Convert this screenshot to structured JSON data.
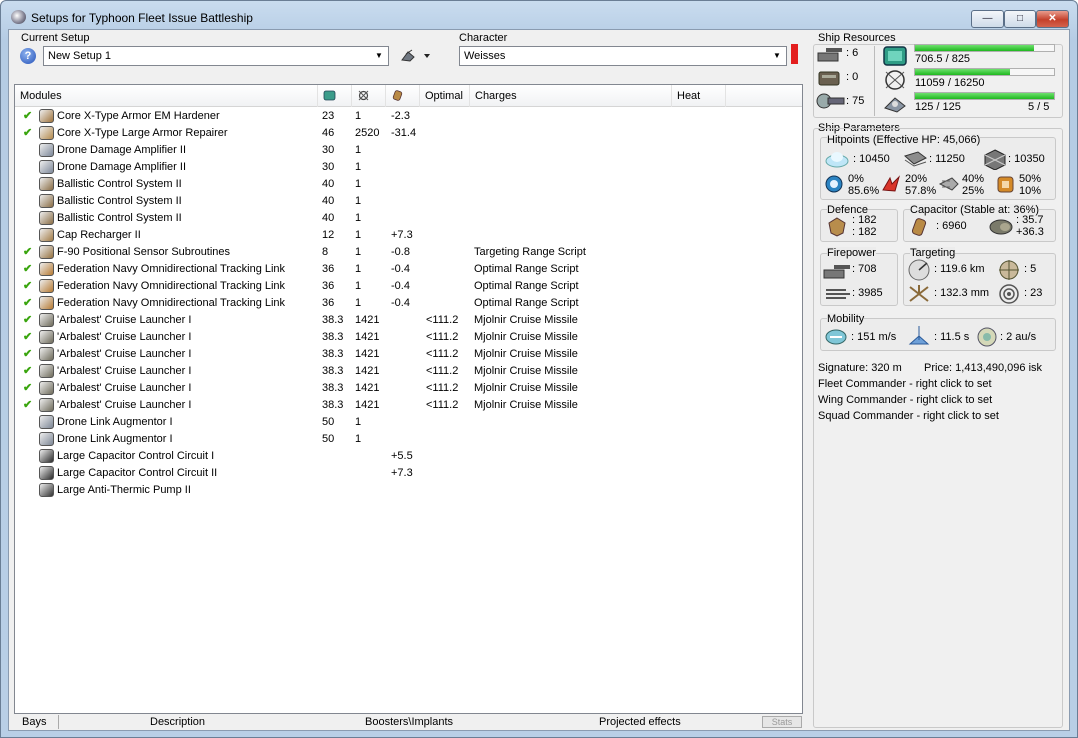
{
  "window": {
    "title": "Setups for Typhoon Fleet Issue Battleship",
    "min": "—",
    "max": "□",
    "close": "✕"
  },
  "setup": {
    "label": "Current Setup",
    "value": "New Setup 1"
  },
  "character": {
    "label": "Character",
    "value": "Weisses"
  },
  "modules": {
    "columns": [
      "Modules",
      "",
      "",
      "",
      "Optimal",
      "Charges",
      "Heat"
    ],
    "column_icons": [
      "cpu-icon",
      "powergrid-icon",
      "capacitor-icon"
    ],
    "rows": [
      {
        "check": "✔",
        "icon": "armor-hardener-icon",
        "name": "Core X-Type Armor EM Hardener",
        "cpu": "23",
        "pg": "1",
        "cap": "-2.3",
        "optimal": "",
        "charge": ""
      },
      {
        "check": "✔",
        "icon": "armor-repairer-icon",
        "name": "Core X-Type Large Armor Repairer",
        "cpu": "46",
        "pg": "2520",
        "cap": "-31.4",
        "optimal": "",
        "charge": ""
      },
      {
        "check": "",
        "icon": "drone-damage-amplifier-icon",
        "name": "Drone Damage Amplifier II",
        "cpu": "30",
        "pg": "1",
        "cap": "",
        "optimal": "",
        "charge": ""
      },
      {
        "check": "",
        "icon": "drone-damage-amplifier-icon",
        "name": "Drone Damage Amplifier II",
        "cpu": "30",
        "pg": "1",
        "cap": "",
        "optimal": "",
        "charge": ""
      },
      {
        "check": "",
        "icon": "ballistic-control-icon",
        "name": "Ballistic Control System II",
        "cpu": "40",
        "pg": "1",
        "cap": "",
        "optimal": "",
        "charge": ""
      },
      {
        "check": "",
        "icon": "ballistic-control-icon",
        "name": "Ballistic Control System II",
        "cpu": "40",
        "pg": "1",
        "cap": "",
        "optimal": "",
        "charge": ""
      },
      {
        "check": "",
        "icon": "ballistic-control-icon",
        "name": "Ballistic Control System II",
        "cpu": "40",
        "pg": "1",
        "cap": "",
        "optimal": "",
        "charge": ""
      },
      {
        "check": "",
        "icon": "cap-recharger-icon",
        "name": "Cap Recharger II",
        "cpu": "12",
        "pg": "1",
        "cap": "+7.3",
        "optimal": "",
        "charge": ""
      },
      {
        "check": "✔",
        "icon": "sensor-subroutines-icon",
        "name": "F-90 Positional Sensor Subroutines",
        "cpu": "8",
        "pg": "1",
        "cap": "-0.8",
        "optimal": "",
        "charge": "Targeting Range Script"
      },
      {
        "check": "✔",
        "icon": "tracking-link-icon",
        "name": "Federation Navy Omnidirectional Tracking Link",
        "cpu": "36",
        "pg": "1",
        "cap": "-0.4",
        "optimal": "",
        "charge": "Optimal Range Script"
      },
      {
        "check": "✔",
        "icon": "tracking-link-icon",
        "name": "Federation Navy Omnidirectional Tracking Link",
        "cpu": "36",
        "pg": "1",
        "cap": "-0.4",
        "optimal": "",
        "charge": "Optimal Range Script"
      },
      {
        "check": "✔",
        "icon": "tracking-link-icon",
        "name": "Federation Navy Omnidirectional Tracking Link",
        "cpu": "36",
        "pg": "1",
        "cap": "-0.4",
        "optimal": "",
        "charge": "Optimal Range Script"
      },
      {
        "check": "✔",
        "icon": "cruise-launcher-icon",
        "name": "'Arbalest' Cruise Launcher I",
        "cpu": "38.3",
        "pg": "1421",
        "cap": "",
        "optimal": "<111.2",
        "charge": "Mjolnir Cruise Missile"
      },
      {
        "check": "✔",
        "icon": "cruise-launcher-icon",
        "name": "'Arbalest' Cruise Launcher I",
        "cpu": "38.3",
        "pg": "1421",
        "cap": "",
        "optimal": "<111.2",
        "charge": "Mjolnir Cruise Missile"
      },
      {
        "check": "✔",
        "icon": "cruise-launcher-icon",
        "name": "'Arbalest' Cruise Launcher I",
        "cpu": "38.3",
        "pg": "1421",
        "cap": "",
        "optimal": "<111.2",
        "charge": "Mjolnir Cruise Missile"
      },
      {
        "check": "✔",
        "icon": "cruise-launcher-icon",
        "name": "'Arbalest' Cruise Launcher I",
        "cpu": "38.3",
        "pg": "1421",
        "cap": "",
        "optimal": "<111.2",
        "charge": "Mjolnir Cruise Missile"
      },
      {
        "check": "✔",
        "icon": "cruise-launcher-icon",
        "name": "'Arbalest' Cruise Launcher I",
        "cpu": "38.3",
        "pg": "1421",
        "cap": "",
        "optimal": "<111.2",
        "charge": "Mjolnir Cruise Missile"
      },
      {
        "check": "✔",
        "icon": "cruise-launcher-icon",
        "name": "'Arbalest' Cruise Launcher I",
        "cpu": "38.3",
        "pg": "1421",
        "cap": "",
        "optimal": "<111.2",
        "charge": "Mjolnir Cruise Missile"
      },
      {
        "check": "",
        "icon": "drone-link-augmentor-icon",
        "name": "Drone Link Augmentor I",
        "cpu": "50",
        "pg": "1",
        "cap": "",
        "optimal": "",
        "charge": ""
      },
      {
        "check": "",
        "icon": "drone-link-augmentor-icon",
        "name": "Drone Link Augmentor I",
        "cpu": "50",
        "pg": "1",
        "cap": "",
        "optimal": "",
        "charge": ""
      },
      {
        "check": "",
        "icon": "capacitor-control-circuit-icon",
        "name": "Large Capacitor Control Circuit I",
        "cpu": "",
        "pg": "",
        "cap": "+5.5",
        "optimal": "",
        "charge": ""
      },
      {
        "check": "",
        "icon": "capacitor-control-circuit-icon",
        "name": "Large Capacitor Control Circuit II",
        "cpu": "",
        "pg": "",
        "cap": "+7.3",
        "optimal": "",
        "charge": ""
      },
      {
        "check": "",
        "icon": "anti-thermic-pump-icon",
        "name": "Large Anti-Thermic Pump II",
        "cpu": "",
        "pg": "",
        "cap": "",
        "optimal": "",
        "charge": ""
      }
    ]
  },
  "bottom_tabs": [
    "Bays",
    "Description",
    "Boosters\\Implants",
    "Projected effects",
    "Stats"
  ],
  "resources": {
    "title": "Ship Resources",
    "turrets": ": 6",
    "launchers": ": 0",
    "calibration": ": 75",
    "cpu": {
      "text": "706.5 / 825",
      "fraction": 0.856
    },
    "powergrid": {
      "text": "11059 / 16250",
      "fraction": 0.681
    },
    "drone_bandwidth": {
      "text": "125 / 125",
      "fraction": 1.0,
      "drones": "5 / 5"
    }
  },
  "params": {
    "title": "Ship Parameters",
    "hitpoints_title": "Hitpoints (Effective HP: 45,066)",
    "shield_hp": ": 10450",
    "armor_hp": ": 11250",
    "structure_hp": ": 10350",
    "resist": [
      {
        "top": "0%",
        "bottom": "85.6%"
      },
      {
        "top": "20%",
        "bottom": "57.8%"
      },
      {
        "top": "40%",
        "bottom": "25%"
      },
      {
        "top": "50%",
        "bottom": "10%"
      }
    ],
    "defence_title": "Defence",
    "defence_1": ": 182",
    "defence_2": ": 182",
    "capacitor_title": "Capacitor (Stable at: 36%)",
    "capacitor_amount": ": 6960",
    "capacitor_delta_1": ": 35.7",
    "capacitor_delta_2": "+36.3",
    "firepower_title": "Firepower",
    "firepower_1": ": 708",
    "firepower_2": ": 3985",
    "targeting_title": "Targeting",
    "target_range": ": 119.6 km",
    "max_targets": ": 5",
    "scan_resolution": ": 132.3 mm",
    "sensor_strength": ": 23",
    "mobility_title": "Mobility",
    "speed": ": 151 m/s",
    "align_time": ": 11.5 s",
    "warp_speed": ": 2 au/s",
    "signature": "Signature: 320 m",
    "price": "Price: 1,413,490,096 isk",
    "fleet_commander": "Fleet Commander - right click to set",
    "wing_commander": "Wing Commander - right click to set",
    "squad_commander": "Squad Commander - right click to set"
  }
}
